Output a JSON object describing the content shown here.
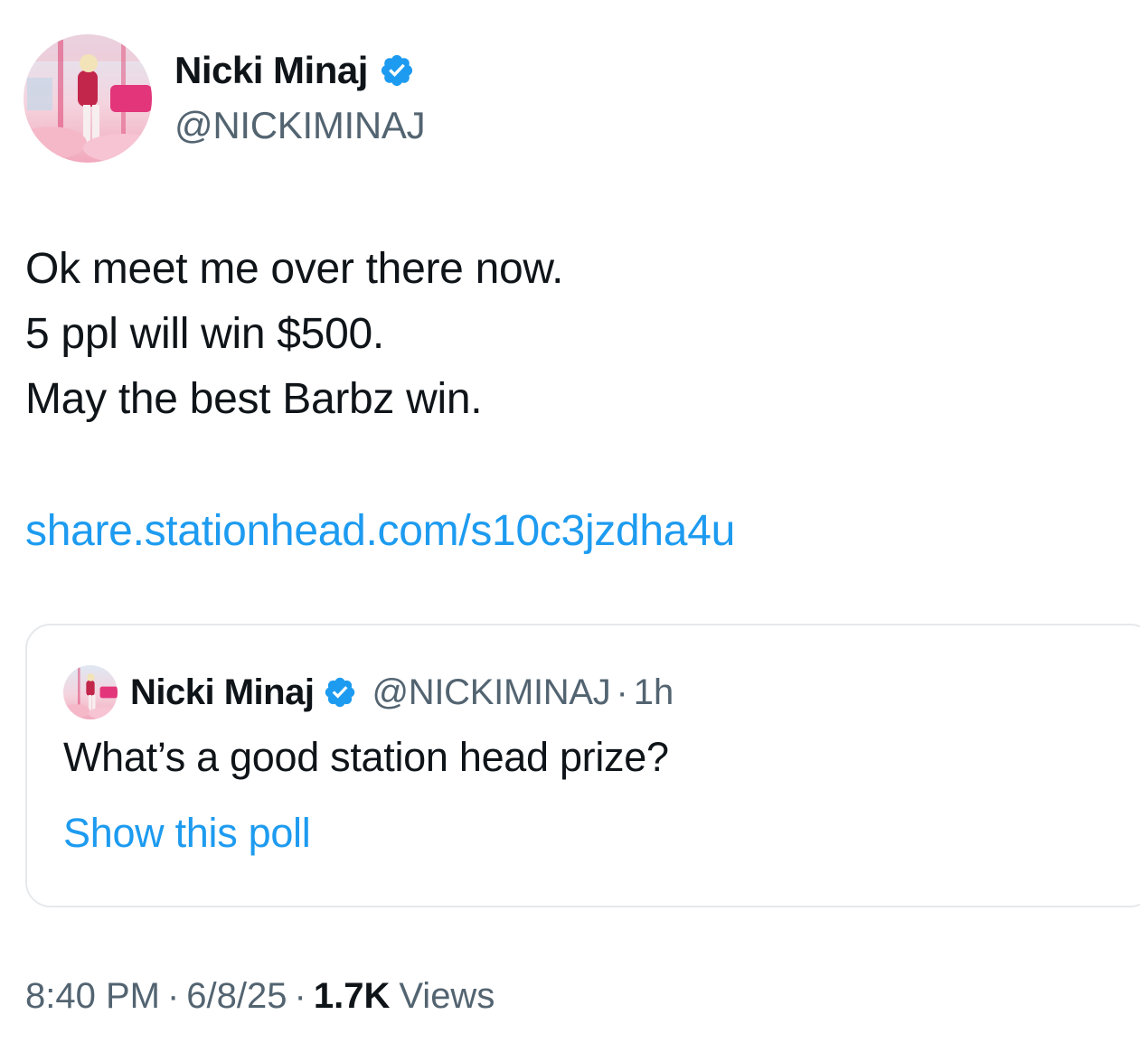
{
  "author": {
    "display_name": "Nicki Minaj",
    "handle": "@NICKIMINAJ",
    "verified": true,
    "verified_color": "#1d9bf0"
  },
  "tweet": {
    "lines": [
      "Ok meet me over there now.",
      "5 ppl will win $500.",
      "May the best Barbz win."
    ],
    "link": "share.stationhead.com/s10c3jzdha4u",
    "link_color": "#1d9bf0"
  },
  "quoted_tweet": {
    "display_name": "Nicki Minaj",
    "handle": "@NICKIMINAJ",
    "separator": "·",
    "time": "1h",
    "text": "What’s a good station head prize?",
    "poll_link": "Show this poll"
  },
  "meta": {
    "time": "8:40 PM",
    "date": "6/8/25",
    "separator": "·",
    "views_count": "1.7K",
    "views_label": "Views"
  }
}
